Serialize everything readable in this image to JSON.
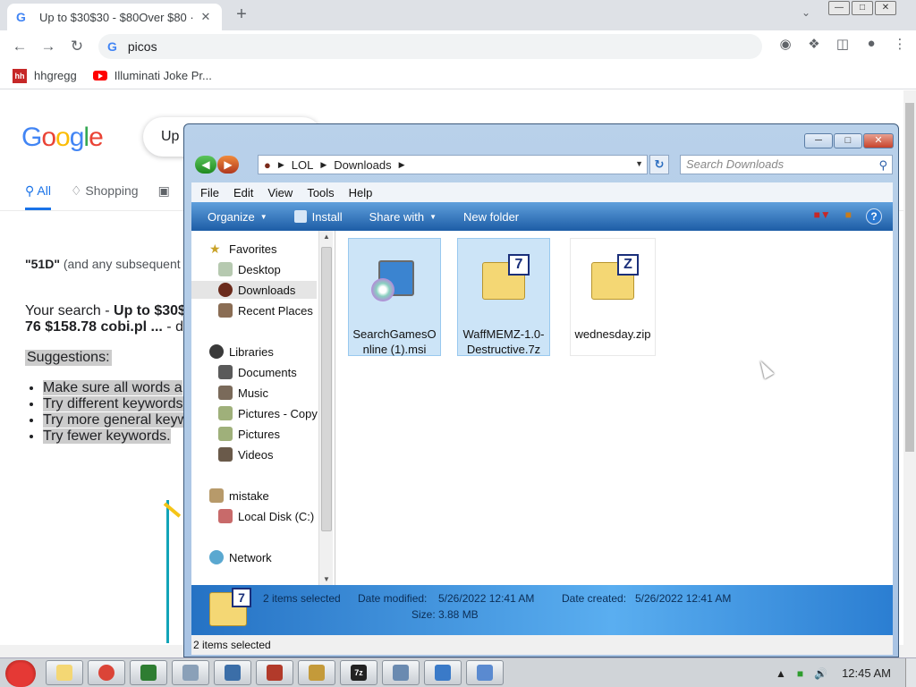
{
  "browser": {
    "tab_title": "Up to $30$30 - $80Over $80 ·",
    "tab_close": "✕",
    "new_tab": "+",
    "window_controls": [
      "—",
      "□",
      "✕"
    ],
    "address_value": "picos",
    "bookmarks": [
      {
        "label": "hhgregg",
        "icon": "hh"
      },
      {
        "label": "Illuminati Joke Pr...",
        "icon": "youtube-icon"
      }
    ]
  },
  "google": {
    "search_value": "Up",
    "tabs": [
      {
        "label": "All",
        "active": true
      },
      {
        "label": "Shopping",
        "active": false
      }
    ],
    "note_bold": "\"51D\"",
    "note_rest": " (and any subsequent",
    "your_search_prefix": "Your search - ",
    "your_search_bold": "Up to $30$",
    "your_search_line2_bold": "76 $158.78 cobi.pl ...",
    "your_search_line2_rest": " - d",
    "suggestions_heading": "Suggestions:",
    "suggestions": [
      "Make sure all words a",
      "Try different keywords",
      "Try more general keyw",
      "Try fewer keywords."
    ]
  },
  "explorer": {
    "breadcrumb": [
      "LOL",
      "Downloads"
    ],
    "search_placeholder": "Search Downloads",
    "menu": [
      "File",
      "Edit",
      "View",
      "Tools",
      "Help"
    ],
    "commands": {
      "organize": "Organize",
      "install": "Install",
      "share": "Share with",
      "new_folder": "New folder"
    },
    "nav": {
      "favorites": "Favorites",
      "desktop": "Desktop",
      "downloads": "Downloads",
      "recent": "Recent Places",
      "libraries": "Libraries",
      "documents": "Documents",
      "music": "Music",
      "pictures_copy": "Pictures - Copy",
      "pictures": "Pictures",
      "videos": "Videos",
      "mistake": "mistake",
      "local_disk": "Local Disk (C:)",
      "network": "Network"
    },
    "files": [
      {
        "name": "SearchGamesOnline (1).msi",
        "selected": true
      },
      {
        "name": "WaffMEMZ-1.0-Destructive.7z",
        "selected": true
      },
      {
        "name": "wednesday.zip",
        "selected": false
      }
    ],
    "details": {
      "selected": "2 items selected",
      "date_modified_label": "Date modified:",
      "date_modified": "5/26/2022 12:41 AM",
      "date_created_label": "Date created:",
      "date_created": "5/26/2022 12:41 AM",
      "size_label": "Size:",
      "size": "3.88 MB"
    },
    "status": "2 items selected",
    "badge_7z": "7",
    "badge_zip": "Z"
  },
  "taskbar": {
    "clock": "12:45 AM",
    "app_7z": "7z"
  }
}
